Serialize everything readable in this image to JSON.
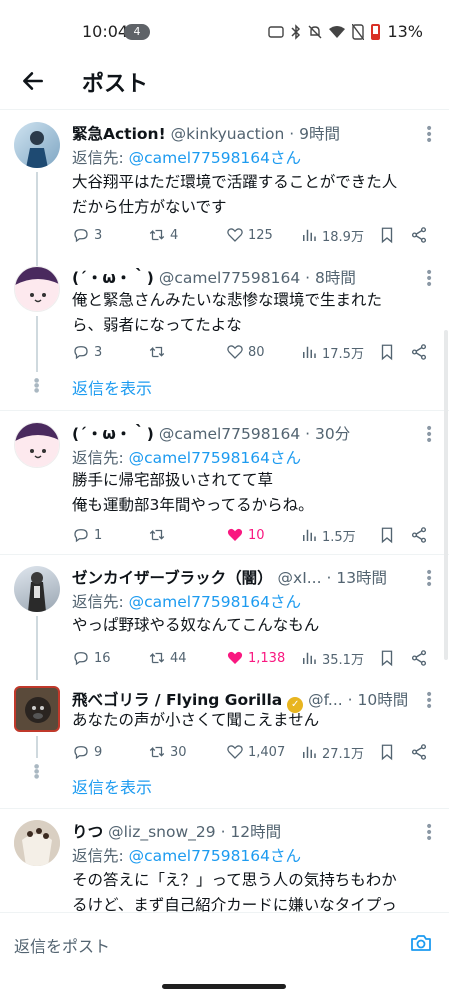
{
  "status_bar": {
    "time": "10:04",
    "notification_count": "4",
    "battery": "13%"
  },
  "header": {
    "title": "ポスト"
  },
  "tweets": [
    {
      "name": "緊急Action!",
      "handle": "@kinkyuaction",
      "time": "· 9時間",
      "reply_label": "返信先: ",
      "reply_to": "@camel77598164さん",
      "text_lines": [
        "大谷翔平はただ環境で活躍することができた人",
        "だから仕方がないです"
      ],
      "replies": "3",
      "reposts": "4",
      "likes": "125",
      "views": "18.9万"
    },
    {
      "name": "(´・ω・｀)",
      "handle": "@camel77598164",
      "time": "· 8時間",
      "text_lines": [
        "俺と緊急さんみたいな悲惨な環境で生まれた",
        "ら、弱者になってたよな"
      ],
      "replies": "3",
      "reposts": "",
      "likes": "80",
      "views": "17.5万",
      "show_replies": "返信を表示"
    },
    {
      "name": "(´・ω・｀)",
      "handle": "@camel77598164",
      "time": "· 30分",
      "reply_label": "返信先: ",
      "reply_to": "@camel77598164さん",
      "text_lines": [
        "勝手に帰宅部扱いされてて草",
        "俺も運動部3年間やってるからね。"
      ],
      "replies": "1",
      "reposts": "",
      "likes": "10",
      "views": "1.5万",
      "liked": true
    },
    {
      "name": "ゼンカイザーブラック（闇）",
      "handle": "@xI...",
      "time": "· 13時間",
      "reply_label": "返信先: ",
      "reply_to": "@camel77598164さん",
      "text_lines": [
        "やっぱ野球やる奴なんてこんなもん"
      ],
      "replies": "16",
      "reposts": "44",
      "likes": "1,138",
      "views": "35.1万",
      "liked": true
    },
    {
      "name": "飛べゴリラ / Flying Gorilla",
      "handle": "@f...",
      "time": "· 10時間",
      "text_lines": [
        "あなたの声が小さくて聞こえません"
      ],
      "replies": "9",
      "reposts": "30",
      "likes": "1,407",
      "views": "27.1万",
      "show_replies": "返信を表示"
    },
    {
      "name": "りつ",
      "handle": "@liz_snow_29",
      "time": "· 12時間",
      "reply_label": "返信先: ",
      "reply_to": "@camel77598164さん",
      "text_lines": [
        "その答えに「え？」って思う人の気持ちもわか",
        "るけど、まず自己紹介カードに嫌いなタイプっ"
      ]
    }
  ],
  "composer": {
    "placeholder": "返信をポスト"
  },
  "colors": {
    "accent": "#1d9bf0",
    "like": "#f91880",
    "text_secondary": "#536471"
  }
}
